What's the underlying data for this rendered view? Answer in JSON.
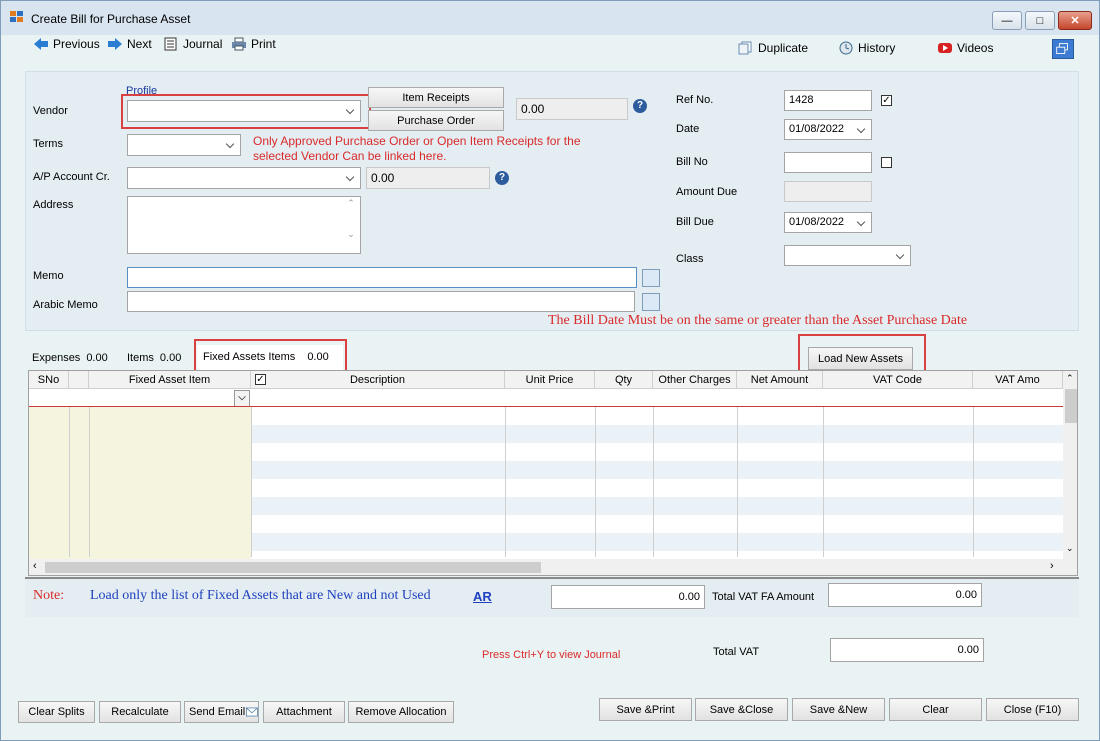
{
  "window": {
    "title": "Create Bill for Purchase Asset"
  },
  "toolbar": {
    "previous": "Previous",
    "next": "Next",
    "journal": "Journal",
    "print": "Print",
    "duplicate": "Duplicate",
    "history": "History",
    "videos": "Videos"
  },
  "form": {
    "profile_link": "Profile",
    "vendor_label": "Vendor",
    "vendor_value": "",
    "item_receipts_button": "Item Receipts",
    "purchase_order_button": "Purchase Order",
    "vendor_balance": "0.00",
    "terms_label": "Terms",
    "terms_value": "",
    "link_note": "Only Approved Purchase Order or Open Item Receipts for the selected Vendor Can be linked here.",
    "ap_account_label": "A/P Account Cr.",
    "ap_account_value": "",
    "ap_balance": "0.00",
    "address_label": "Address",
    "address_value": "",
    "memo_label": "Memo",
    "memo_value": "",
    "arabic_memo_label": "Arabic Memo",
    "arabic_memo_value": "",
    "ref_no_label": "Ref No.",
    "ref_no_value": "1428",
    "ref_no_checked": true,
    "date_label": "Date",
    "date_value": "01/08/2022",
    "bill_no_label": "Bill No",
    "bill_no_value": "",
    "bill_no_checked": false,
    "amount_due_label": "Amount Due",
    "amount_due_value": "",
    "bill_due_label": "Bill Due",
    "bill_due_value": "01/08/2022",
    "class_label": "Class",
    "class_value": "",
    "bill_date_note": "The Bill Date Must be on the same or greater than the Asset Purchase Date"
  },
  "tabs": [
    {
      "label": "Expenses",
      "amount": "0.00"
    },
    {
      "label": "Items",
      "amount": "0.00"
    },
    {
      "label": "Fixed Assets Items",
      "amount": "0.00"
    }
  ],
  "load_new_assets_button": "Load New Assets",
  "grid": {
    "columns": [
      "SNo",
      "Fixed Asset Item",
      "Description",
      "Unit Price",
      "Qty",
      "Other Charges",
      "Net Amount",
      "VAT Code",
      "VAT Amo"
    ]
  },
  "footer": {
    "note_label": "Note:",
    "note_text": "Load only the list of Fixed Assets that are New and not Used",
    "ar_link": "AR",
    "fa_total_value": "0.00",
    "total_vat_fa_label": "Total VAT FA Amount",
    "total_vat_fa_value": "0.00",
    "journal_hint": "Press Ctrl+Y to view Journal",
    "total_vat_label": "Total VAT",
    "total_vat_value": "0.00"
  },
  "buttons": {
    "clear_splits": "Clear Splits",
    "recalculate": "Recalculate",
    "send_email": "Send Email",
    "attachment": "Attachment",
    "remove_allocation": "Remove Allocation",
    "save_print": "Save &Print",
    "save_close": "Save &Close",
    "save_new": "Save &New",
    "clear": "Clear",
    "close": "Close (F10)"
  },
  "colors": {
    "accent_red": "#d94040",
    "note_blue": "#1f3fbf",
    "title_bar": "#d8e4ef"
  }
}
